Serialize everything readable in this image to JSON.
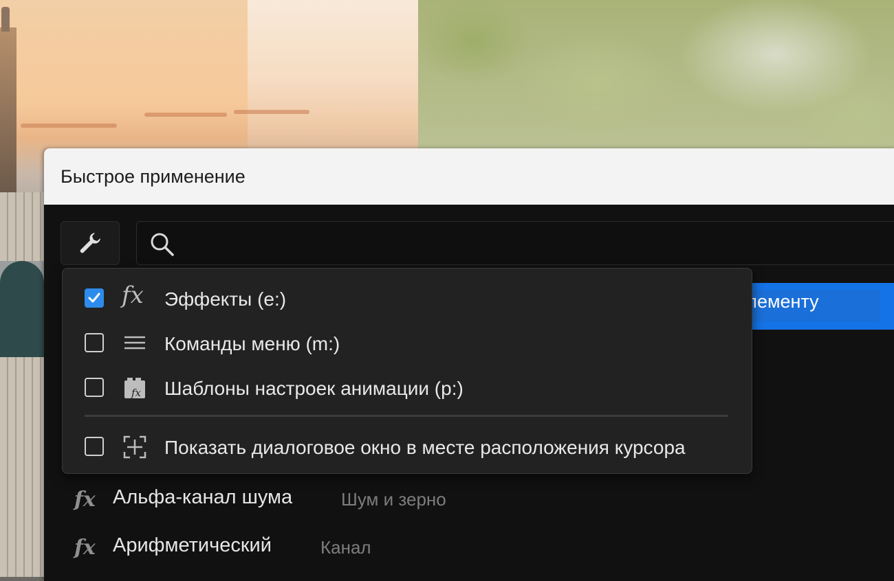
{
  "dialog": {
    "title": "Быстрое применение",
    "search": {
      "value": "",
      "placeholder": ""
    }
  },
  "filter_menu": {
    "items": [
      {
        "label": "Эффекты (e:)",
        "checked": true,
        "icon": "fx-icon"
      },
      {
        "label": "Команды меню (m:)",
        "checked": false,
        "icon": "menu-lines-icon"
      },
      {
        "label": "Шаблоны настроек анимации (p:)",
        "checked": false,
        "icon": "animation-preset-icon"
      }
    ],
    "option": {
      "label": "Показать диалоговое окно в месте расположения курсора",
      "checked": false,
      "icon": "cursor-position-icon"
    }
  },
  "results": {
    "highlighted_fragment": "элементу",
    "items": [
      {
        "name": "Альфа-канал шума",
        "category": "Шум и зерно"
      },
      {
        "name": "Арифметический",
        "category": "Канал"
      }
    ]
  },
  "colors": {
    "accent": "#1473e6",
    "checkbox_checked": "#2d8ceb",
    "dialog_bg": "#111111",
    "menu_bg": "#222222"
  }
}
